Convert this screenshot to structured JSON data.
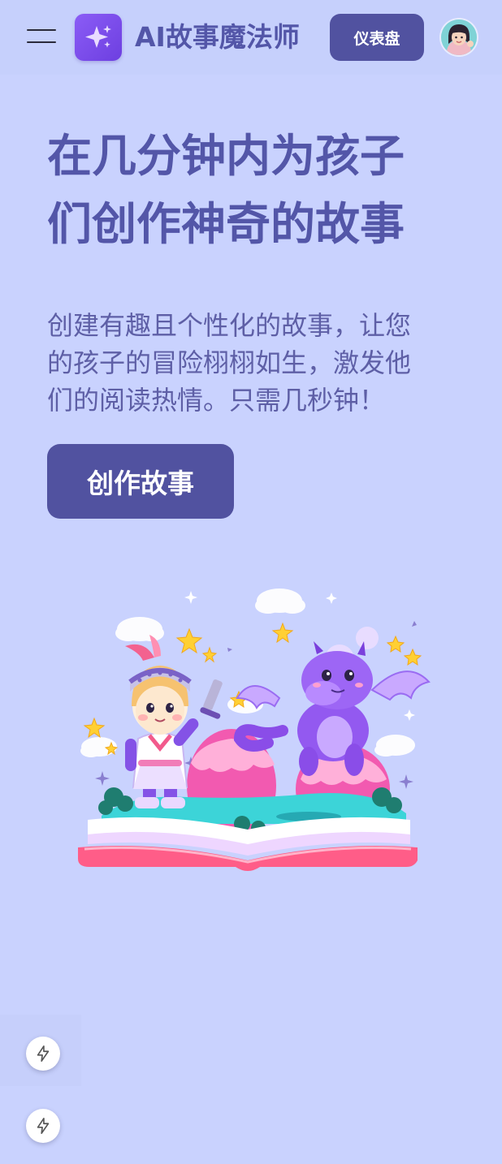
{
  "header": {
    "app_title": "AI故事魔法师",
    "dashboard_label": "仪表盘",
    "menu_icon": "hamburger-menu-icon",
    "logo_icon": "sparkle-stars-icon"
  },
  "hero": {
    "title_line1": "在几分钟内为孩子",
    "title_line2": "们创作神奇的故事",
    "subtitle_line1": "创建有趣且个性化的故事，让您",
    "subtitle_line2": "的孩子的冒险栩栩如生，激发他",
    "subtitle_line3": "们的阅读热情。只需几秒钟！",
    "cta_label": "创作故事"
  },
  "floating": {
    "icon": "lightning-bolt-icon"
  },
  "colors": {
    "background": "#c9d2fe",
    "primary": "#5152a0",
    "title_text": "#5356a8",
    "logo_purple": "#7c4dee"
  }
}
